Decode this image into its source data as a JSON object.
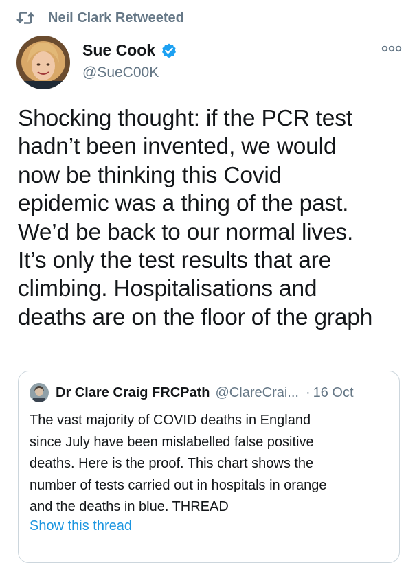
{
  "retweet": {
    "icon": "retweet-icon",
    "label": "Neil Clark Retweeted"
  },
  "tweet": {
    "author_name": "Sue Cook",
    "verified_icon": "verified-badge-icon",
    "handle": "@SueC00K",
    "more_icon": "more-options-icon",
    "text_lines": [
      "Shocking thought: if the PCR test",
      "hadn’t been invented, we would",
      "now be thinking this Covid",
      "epidemic was a thing of the past.",
      "We’d be back to our normal lives.",
      "It’s only the test results that are",
      "climbing. Hospitalisations and",
      "deaths are on the floor of the graph"
    ]
  },
  "quote": {
    "author_name": "Dr Clare Craig FRCPath",
    "handle": "@ClareCrai...",
    "separator": "·",
    "date": "16 Oct",
    "text_lines": [
      "The vast majority of COVID deaths in England",
      "since July have been mislabelled false positive",
      "deaths. Here is the proof. This chart shows the",
      "number of tests carried out in hospitals in orange",
      "and the deaths in blue. THREAD"
    ],
    "show_thread": "Show this thread"
  },
  "colors": {
    "text": "#14171a",
    "secondary": "#657786",
    "link": "#1b95e0",
    "verified": "#1da1f2",
    "border": "#ccd6dd"
  }
}
